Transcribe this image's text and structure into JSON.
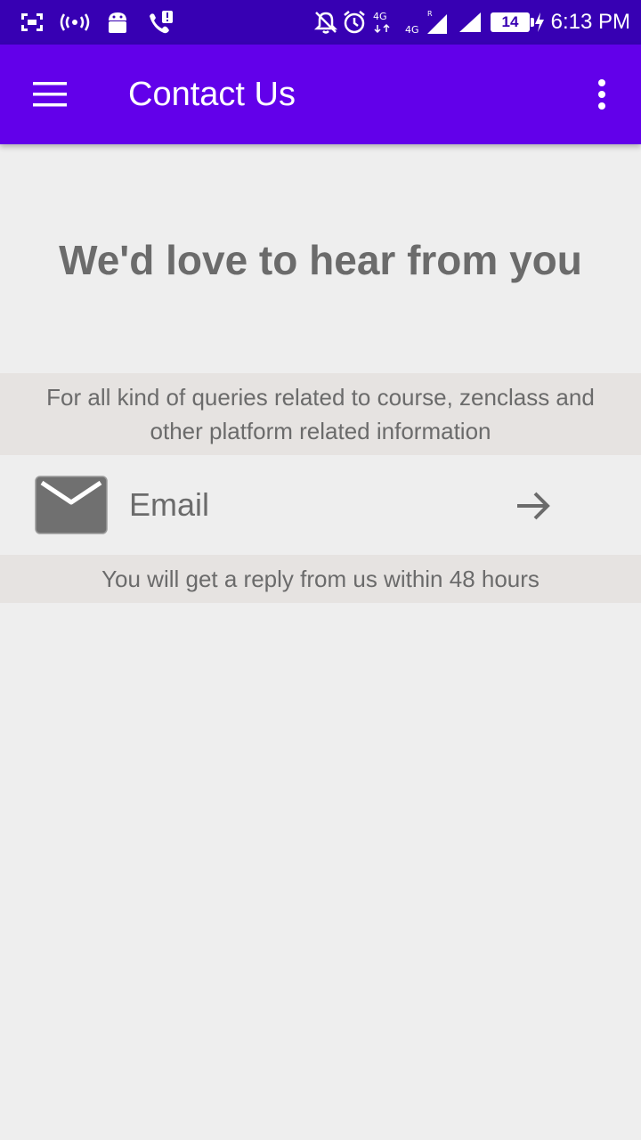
{
  "status_bar": {
    "time": "6:13 PM",
    "battery": "14",
    "icons": [
      "screenshot-icon",
      "hotspot-icon",
      "android-icon",
      "call-alert-icon",
      "notifications-off-icon",
      "alarm-icon",
      "network-4g-icon",
      "signal-4g-icon",
      "signal-icon",
      "battery-icon",
      "charging-icon"
    ],
    "network_label": "4G"
  },
  "app_bar": {
    "title": "Contact Us",
    "color": "#6200ea"
  },
  "main": {
    "headline": "We'd love to hear from you",
    "info_text": "For all kind of queries related to course, zenclass and other platform related information",
    "email_label": "Email",
    "reply_text": "You will get a reply from us within 48 hours"
  },
  "colors": {
    "status_bar": "#3700b3",
    "text": "#6b6b6b",
    "band": "#e6e3e1",
    "background": "#eeeeee"
  }
}
